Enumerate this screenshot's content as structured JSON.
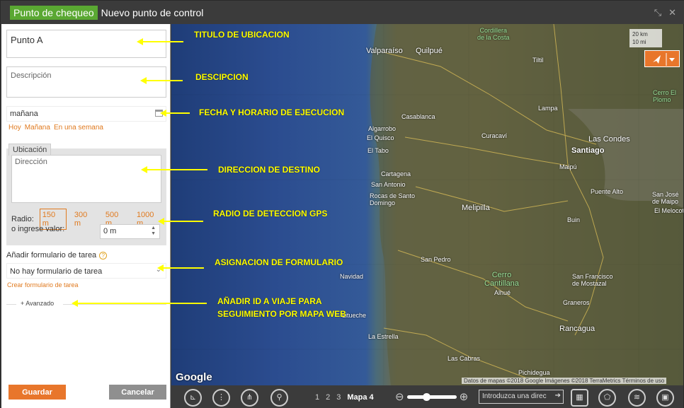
{
  "window": {
    "badge": "Punto de chequeo",
    "title": "Nuevo punto de control"
  },
  "form": {
    "name_value": "Punto A",
    "description_placeholder": "Descripción",
    "date_value": "mañana",
    "quick_dates": [
      "Hoy",
      "Mañana",
      "En una semana"
    ],
    "location_tab": "Ubicación",
    "address_placeholder": "Dirección",
    "radius_label": "Radio:",
    "radius_options": [
      "150 m",
      "300 m",
      "500 m",
      "1000 m"
    ],
    "radius_selected": "150 m",
    "custom_label": "o ingrese valor:",
    "custom_value": "0  m",
    "task_form_label": "Añadir formulario de tarea",
    "task_form_value": "No hay formulario de tarea",
    "create_form_link": "Crear formulario de tarea",
    "advanced_label": "Avanzado",
    "save_label": "Guardar",
    "cancel_label": "Cancelar"
  },
  "map": {
    "scale": [
      "20 km",
      "10 mi"
    ],
    "attribution": "Datos de mapas ©2018 Google Imágenes ©2018 TerraMetrics   Términos de uso",
    "logo": "Google",
    "labels": {
      "cordillera": "Cordillera\nde la Costa",
      "valparaiso": "Valparaíso",
      "quilpue": "Quilpué",
      "tiltil": "Tiltil",
      "casablanca": "Casablanca",
      "lampa": "Lampa",
      "cerro_el_plomo": "Cerro El\nPlomo",
      "curacavi": "Curacaví",
      "algarrobo": "Algarrobo",
      "el_quisco": "El Quisco",
      "el_tabo": "El Tabo",
      "las_condes": "Las Condes",
      "santiago": "Santiago",
      "maipu": "Maipú",
      "cartagena": "Cartagena",
      "san_antonio": "San Antonio",
      "rocas": "Rocas de Santo\nDomingo",
      "puente_alto": "Puente Alto",
      "san_jose": "San José\nde Maipo",
      "melipilla": "Melipilla",
      "el_melocoton": "El Melocotón",
      "buin": "Buin",
      "san_pedro": "San Pedro",
      "navidad": "Navidad",
      "cerro_cantillana": "Cerro\nCantillana",
      "alhue": "Alhué",
      "graneros": "Graneros",
      "san_francisco": "San Francisco\nde Mostazal",
      "rancagua": "Rancagua",
      "las_cabras": "Las Cabras",
      "pichidegua": "Pichidegua",
      "litueche": "Litueche",
      "la_estrella": "La Estrella",
      "lampa_road": "Lampa",
      "graneros2": "Graneros"
    }
  },
  "bottombar": {
    "map_tabs": [
      "1",
      "2",
      "3",
      "Mapa 4"
    ],
    "active_tab": "Mapa 4",
    "address_search": "Introduzca una direc"
  },
  "annotations": {
    "title": "TITULO DE UBICACION",
    "desc": "DESCIPCION",
    "date": "FECHA Y HORARIO DE EJECUCION",
    "addr": "DIRECCION DE DESTINO",
    "radius": "RADIO DE DETECCION GPS",
    "form": "ASIGNACION DE FORMULARIO",
    "adv1": "AÑADIR ID A VIAJE PARA",
    "adv2": "SEGUIMIENTO POR MAPA WEB"
  },
  "colors": {
    "accent_orange": "#e8762b",
    "badge_green": "#5aa832",
    "annotation_yellow": "#ffff00"
  }
}
